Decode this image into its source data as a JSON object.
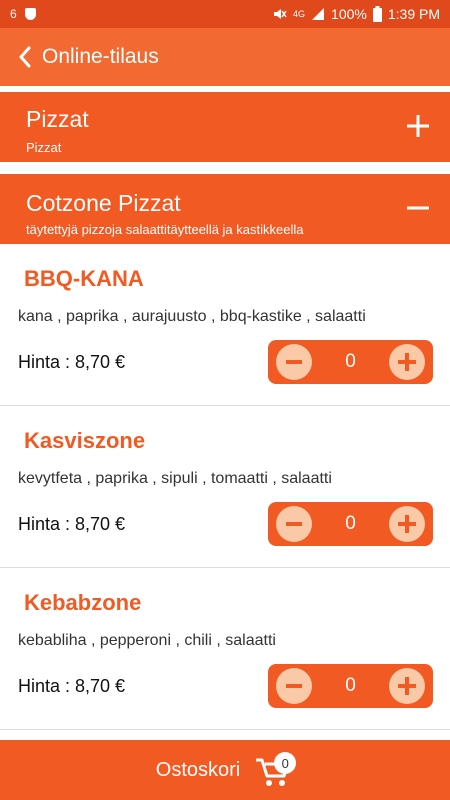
{
  "status_bar": {
    "notification_count": "6",
    "network": "4G",
    "battery": "100%",
    "time": "1:39 PM"
  },
  "app_bar": {
    "title": "Online-tilaus"
  },
  "categories": [
    {
      "title": "Pizzat",
      "subtitle": "Pizzat",
      "toggle": "plus-icon",
      "expanded": false
    },
    {
      "title": "Cotzone Pizzat",
      "subtitle": "täytettyjä pizzoja salaattitäytteellä ja kastikkeella",
      "toggle": "minus-icon",
      "expanded": true
    }
  ],
  "items": [
    {
      "name": "BBQ-KANA",
      "ingredients": "kana , paprika , aurajuusto , bbq-kastike , salaatti",
      "price": "Hinta : 8,70 €",
      "quantity": "0"
    },
    {
      "name": "Kasviszone",
      "ingredients": "kevytfeta , paprika , sipuli , tomaatti , salaatti",
      "price": "Hinta : 8,70 €",
      "quantity": "0"
    },
    {
      "name": "Kebabzone",
      "ingredients": "kebabliha , pepperoni , chili , salaatti",
      "price": "Hinta : 8,70 €",
      "quantity": "0"
    }
  ],
  "cart": {
    "label": "Ostoskori",
    "count": "0"
  },
  "colors": {
    "accent": "#f15a22",
    "app_bar": "#f26a31",
    "status_bar": "#e0491b",
    "stepper_button": "#f9c9a8"
  }
}
